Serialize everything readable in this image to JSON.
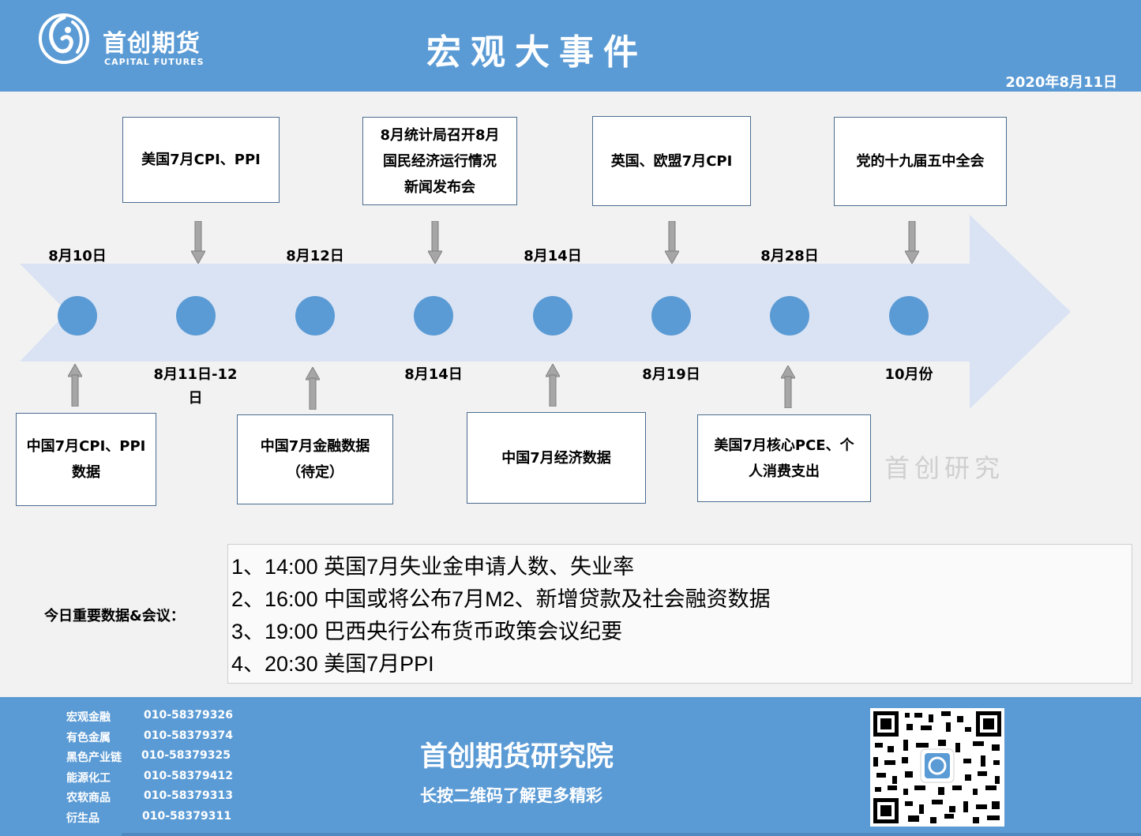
{
  "header": {
    "logo_cn": "首创期货",
    "logo_en": "CAPITAL FUTURES",
    "title": "宏观大事件",
    "date": "2020年8月11日"
  },
  "timeline": {
    "top_dates": [
      "8月10日",
      "8月12日",
      "8月14日",
      "8月28日"
    ],
    "bottom_dates": [
      "8月11日-12\n日",
      "8月14日",
      "8月19日",
      "10月份"
    ],
    "top_events": [
      "美国7月CPI、PPI",
      "8月统计局召开8月\n国民经济运行情况\n新闻发布会",
      "英国、欧盟7月CPI",
      "党的十九届五中全会"
    ],
    "bottom_events": [
      "中国7月CPI、PPI\n数据",
      "中国7月金融数据\n（待定）",
      "中国7月经济数据",
      "美国7月核心PCE、个\n人消费支出"
    ]
  },
  "watermark": "首创研究",
  "today": {
    "label": "今日重要数据&会议：",
    "items": [
      "1、14:00 英国7月失业金申请人数、失业率",
      "2、16:00 中国或将公布7月M2、新增贷款及社会融资数据",
      "3、19:00 巴西央行公布货币政策会议纪要",
      "4、20:30 美国7月PPI"
    ]
  },
  "footer": {
    "contacts": [
      {
        "name": "宏观金融",
        "phone": "010-58379326"
      },
      {
        "name": "有色金属",
        "phone": "010-58379374"
      },
      {
        "name": "黑色产业链",
        "phone": "010-58379325"
      },
      {
        "name": "能源化工",
        "phone": "010-58379412"
      },
      {
        "name": "农软商品",
        "phone": "010-58379313"
      },
      {
        "name": "衍生品",
        "phone": "010-58379311"
      }
    ],
    "title": "首创期货研究院",
    "subtitle": "长按二维码了解更多精彩"
  },
  "colors": {
    "brand_blue": "#5b9bd5",
    "arrow_fill": "#dae3f3",
    "dot_fill": "#5b9bd5"
  }
}
